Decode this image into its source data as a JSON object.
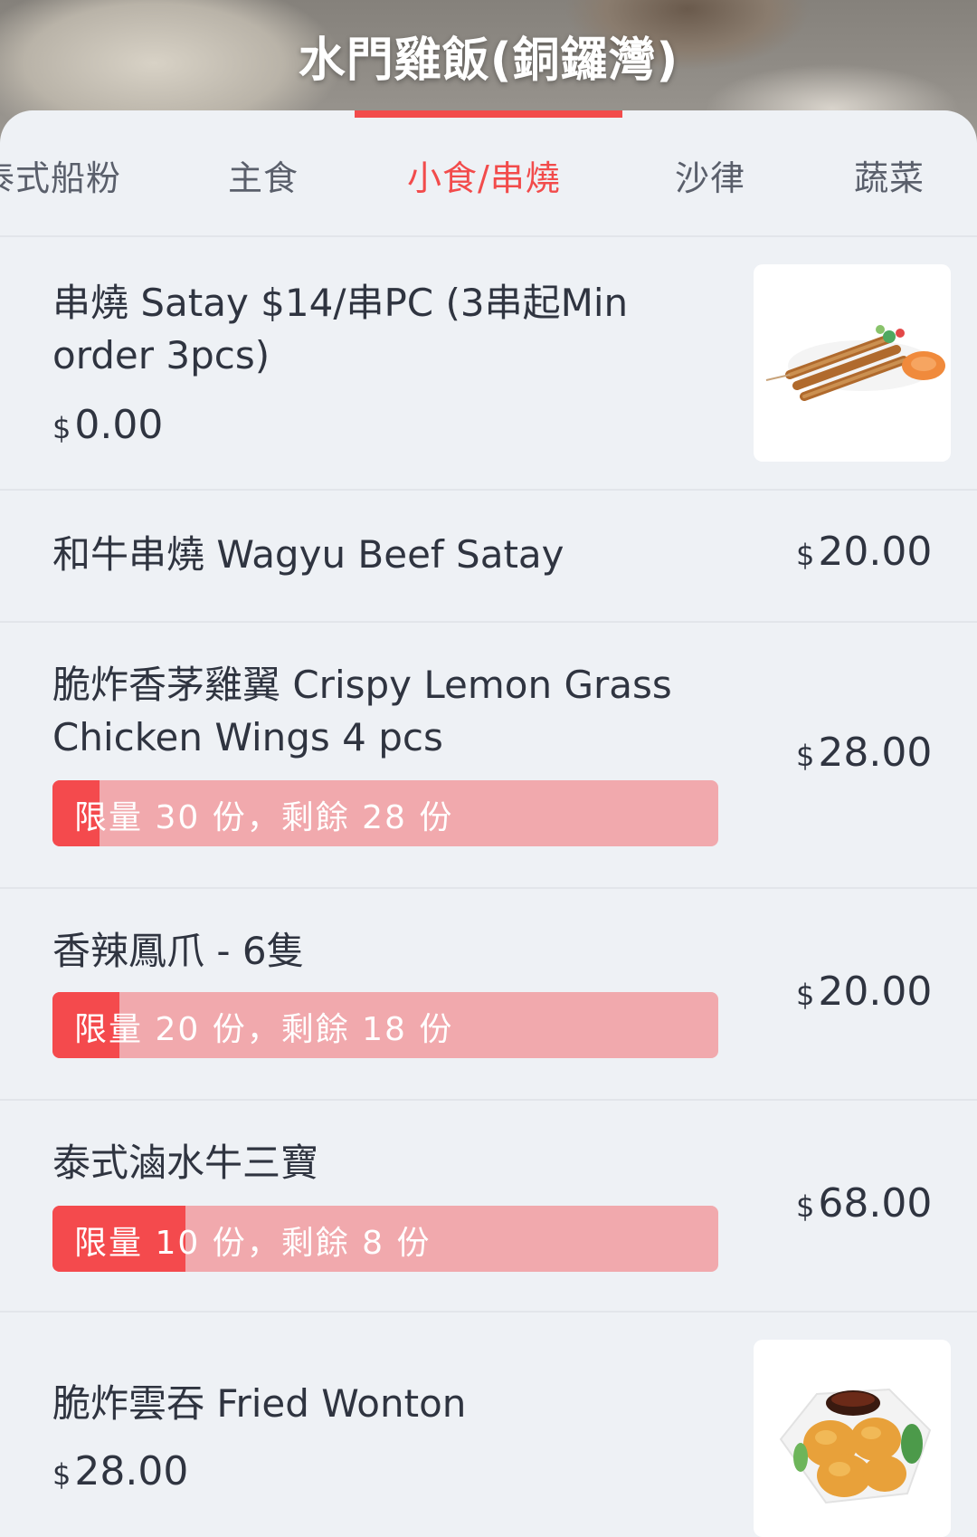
{
  "store": {
    "title": "水門雞飯(銅鑼灣)"
  },
  "tabs": [
    {
      "label": "泰式船粉"
    },
    {
      "label": "主食"
    },
    {
      "label": "小食/串燒",
      "active": true
    },
    {
      "label": "沙律"
    },
    {
      "label": "蔬菜"
    }
  ],
  "currency_symbol": "$",
  "items": [
    {
      "name": "串燒 Satay $14/串PC (3串起Min order 3pcs)",
      "price": "0.00",
      "image": "satay-skewers-photo"
    },
    {
      "name": "和牛串燒 Wagyu Beef Satay",
      "price": "20.00"
    },
    {
      "name": "脆炸香茅雞翼 Crispy Lemon Grass Chicken Wings 4 pcs",
      "price": "28.00",
      "limit_text": "限量 30 份，剩餘 28 份",
      "limit_progress": 0.07
    },
    {
      "name": "香辣鳳爪 - 6隻",
      "price": "20.00",
      "limit_text": "限量 20 份，剩餘 18 份",
      "limit_progress": 0.1
    },
    {
      "name": "泰式滷水牛三寶",
      "price": "68.00",
      "limit_text": "限量 10 份，剩餘 8 份",
      "limit_progress": 0.2
    },
    {
      "name": "脆炸雲吞 Fried Wonton",
      "price": "28.00",
      "image": "fried-wonton-photo"
    }
  ],
  "colors": {
    "accent": "#f24b4b",
    "limit_bar": "#f1a9ad",
    "limit_fill": "#f44a4d"
  }
}
